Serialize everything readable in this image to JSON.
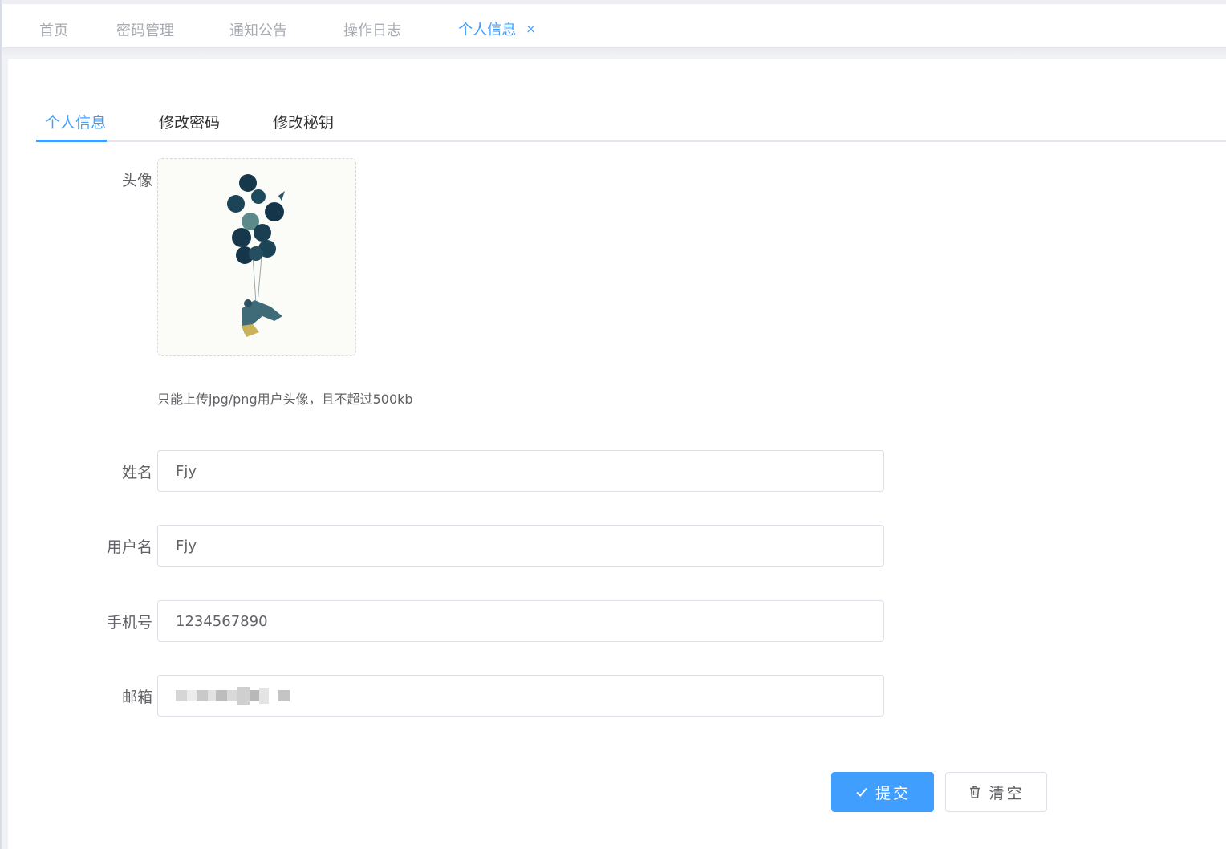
{
  "top_tabs": [
    {
      "label": "首页"
    },
    {
      "label": "密码管理"
    },
    {
      "label": "通知公告"
    },
    {
      "label": "操作日志"
    },
    {
      "label": "个人信息",
      "active": true,
      "closable": true
    }
  ],
  "top_tab_close_glyph": "×",
  "inner_tabs": [
    {
      "label": "个人信息",
      "active": true
    },
    {
      "label": "修改密码"
    },
    {
      "label": "修改秘钥"
    }
  ],
  "form": {
    "avatar_label": "头像",
    "upload_tip": "只能上传jpg/png用户头像，且不超过500kb",
    "name_label": "姓名",
    "name_value": "Fjy",
    "username_label": "用户名",
    "username_value": "Fjy",
    "phone_label": "手机号",
    "phone_value": "1234567890",
    "email_label": "邮箱"
  },
  "buttons": {
    "submit_label": "提交",
    "clear_label": "清空"
  },
  "colors": {
    "accent": "#409eff",
    "text": "#606266",
    "muted_tab": "#a8abb2"
  },
  "icons": [
    "close-icon",
    "check-icon",
    "trash-icon"
  ]
}
